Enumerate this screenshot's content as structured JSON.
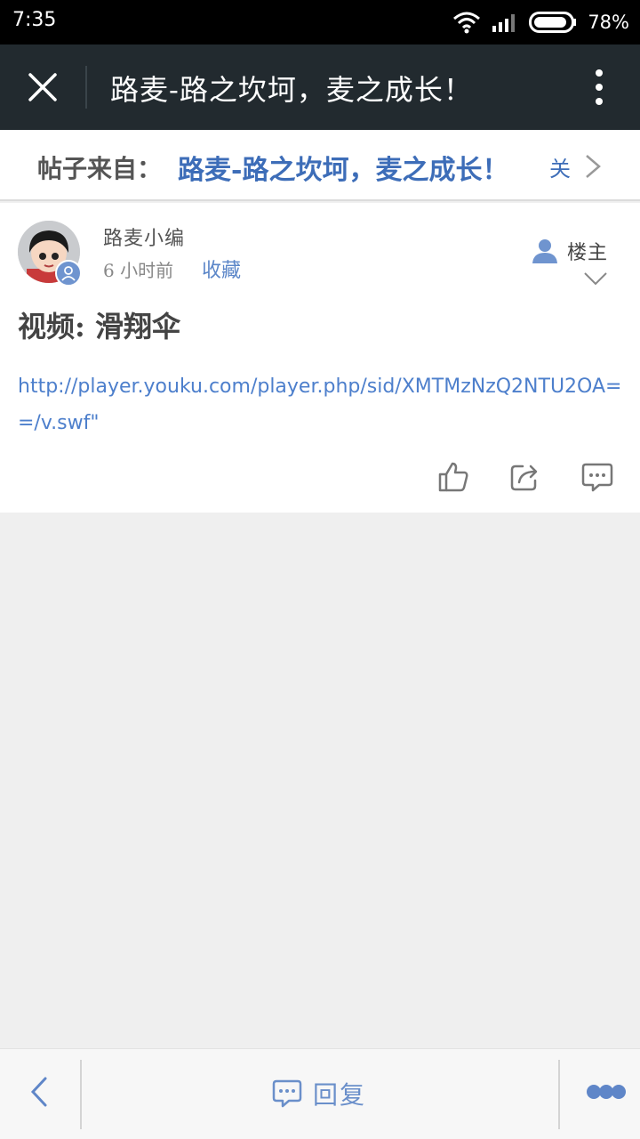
{
  "status_bar": {
    "time": "7:35",
    "battery": "78%"
  },
  "title_bar": {
    "title": "路麦-路之坎坷，麦之成长！"
  },
  "source": {
    "label": "帖子来自：",
    "name": "路麦-路之坎坷，麦之成长！",
    "follow": "关"
  },
  "post": {
    "author": "路麦小编",
    "time": "6 小时前",
    "favorite": "收藏",
    "op_label": "楼主",
    "title": "视频: 滑翔伞",
    "link": "http://player.youku.com/player.php/sid/XMTMzNzQ2NTU2OA==/v.swf\""
  },
  "bottom_bar": {
    "reply": "回复"
  },
  "colors": {
    "accent": "#3d6db8",
    "title_bar_bg": "#222a2f",
    "link": "#4d7fcc"
  }
}
